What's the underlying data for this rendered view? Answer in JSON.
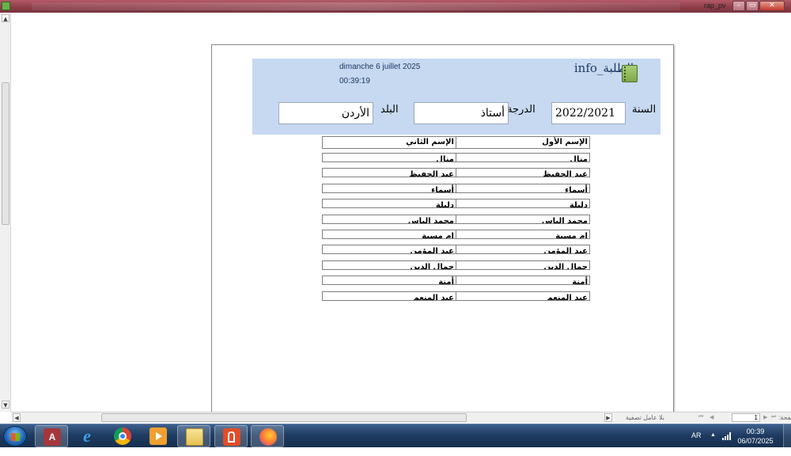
{
  "window": {
    "title": "rap_pv",
    "buttons": {
      "minimize": "–",
      "maximize": "▭",
      "close": "✕"
    }
  },
  "report": {
    "title": "الطلبة_info",
    "date": "dimanche 6 juillet 2025",
    "time": "00:39:19",
    "fields": {
      "year_label": "السنة",
      "year_value": "2022/2021",
      "rank_label": "الدرجة",
      "rank_value": "أستاذ",
      "country_label": "البلد",
      "country_value": "الأردن"
    },
    "table": {
      "headers": [
        "الإسم الأول",
        "الإسم الثاني"
      ],
      "rows": [
        [
          "منال",
          "منال"
        ],
        [
          "عبد الحفيظ",
          "عبد الحفيظ"
        ],
        [
          "أسماء",
          "أسماء"
        ],
        [
          "دليلة",
          "دليلة"
        ],
        [
          "محمد الياس",
          "محمد الياس"
        ],
        [
          "ام مسية",
          "ام مسية"
        ],
        [
          "عبد المؤمن",
          "عبد المؤمن"
        ],
        [
          "جمال الدين",
          "جمال الدين"
        ],
        [
          "أمنة",
          "أمنة"
        ],
        [
          "عبد المنعم",
          "عبد المنعم"
        ]
      ]
    }
  },
  "statusbar": {
    "filter_label": "بلا عامل تصفية",
    "page_label": "صفحة:",
    "page_value": "1"
  },
  "taskbar": {
    "apps": [
      "access-app",
      "internet-explorer",
      "chrome",
      "media-player",
      "file-explorer",
      "acrobat",
      "firefox"
    ],
    "language": "AR",
    "clock_time": "00:39",
    "clock_date": "06/07/2025"
  }
}
